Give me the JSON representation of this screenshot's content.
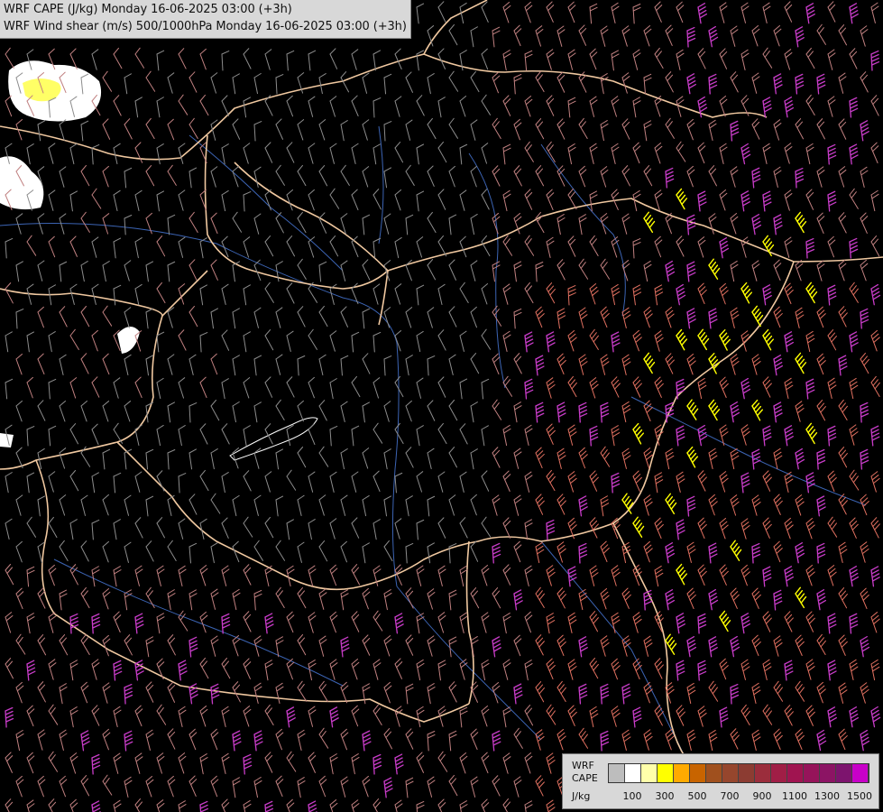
{
  "header": {
    "line1": "WRF CAPE (J/kg) Monday 16-06-2025 03:00 (+3h)",
    "line2": "WRF Wind shear (m/s) 500/1000hPa Monday 16-06-2025 03:00 (+3h)"
  },
  "legend": {
    "label_lines": [
      "WRF",
      "CAPE",
      "J/kg"
    ],
    "swatch_colors": [
      "#bdbdbd",
      "#ffffff",
      "#ffffaa",
      "#ffff00",
      "#ffaa00",
      "#c86400",
      "#a0501e",
      "#96462d",
      "#8c3c32",
      "#9b2d3c",
      "#a01e46",
      "#a01450",
      "#96145a",
      "#8c1464",
      "#7d146e",
      "#c800c8"
    ],
    "ticks": [
      {
        "label": "100",
        "index": 1
      },
      {
        "label": "300",
        "index": 3
      },
      {
        "label": "500",
        "index": 5
      },
      {
        "label": "700",
        "index": 7
      },
      {
        "label": "900",
        "index": 9
      },
      {
        "label": "1100",
        "index": 11
      },
      {
        "label": "1300",
        "index": 13
      },
      {
        "label": "1500",
        "index": 15
      }
    ]
  },
  "map": {
    "background_color": "#000000",
    "border_color": "#f0c8a0",
    "river_color": "#3c64b4",
    "barb_colors": {
      "weak": "#8c8c8c",
      "light": "#c08080",
      "moderate": "#e07060",
      "strong": "#c83cc8",
      "highlight": "#ffff00"
    }
  }
}
